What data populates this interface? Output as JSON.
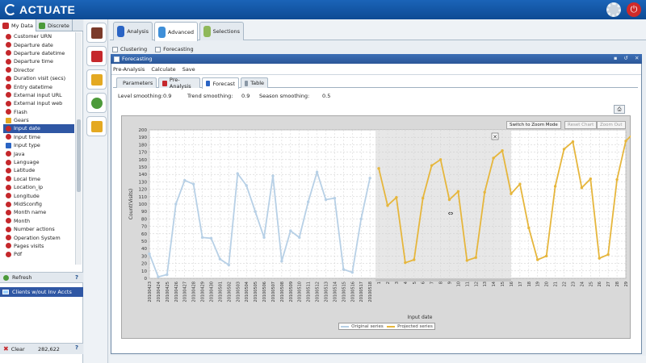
{
  "app": {
    "logo_text": "ACTUATE",
    "settings_icon": "gear-icon",
    "power_icon": "power-icon",
    "power_glyph": "⏻"
  },
  "left_panel": {
    "tabs": [
      {
        "label": "My Data",
        "color": "#c5282c",
        "active": true
      },
      {
        "label": "Discrete",
        "color": "#4c9a3a",
        "active": false
      }
    ],
    "fields": [
      {
        "label": "Customer URN",
        "icon": "red"
      },
      {
        "label": "Departure date",
        "icon": "red"
      },
      {
        "label": "Departure datetime",
        "icon": "red"
      },
      {
        "label": "Departure time",
        "icon": "red"
      },
      {
        "label": "Director",
        "icon": "red"
      },
      {
        "label": "Duration visit (secs)",
        "icon": "red"
      },
      {
        "label": "Entry datetime",
        "icon": "red"
      },
      {
        "label": "External input URL",
        "icon": "red"
      },
      {
        "label": "External input web",
        "icon": "red"
      },
      {
        "label": "Flash",
        "icon": "red"
      },
      {
        "label": "Gears",
        "icon": "yellow"
      },
      {
        "label": "Input date",
        "icon": "red",
        "selected": true
      },
      {
        "label": "Input time",
        "icon": "red"
      },
      {
        "label": "Input type",
        "icon": "blue"
      },
      {
        "label": "Java",
        "icon": "red"
      },
      {
        "label": "Language",
        "icon": "red"
      },
      {
        "label": "Latitude",
        "icon": "red"
      },
      {
        "label": "Local time",
        "icon": "red"
      },
      {
        "label": "Location_ip",
        "icon": "red"
      },
      {
        "label": "Longitude",
        "icon": "red"
      },
      {
        "label": "MidSconfig",
        "icon": "red"
      },
      {
        "label": "Month name",
        "icon": "red"
      },
      {
        "label": "Month",
        "icon": "red"
      },
      {
        "label": "Number actions",
        "icon": "red"
      },
      {
        "label": "Operation System",
        "icon": "red"
      },
      {
        "label": "Pages visits",
        "icon": "red"
      },
      {
        "label": "Pdf",
        "icon": "red"
      }
    ],
    "refresh_label": "Refresh",
    "help_glyph": "?",
    "segment_label": "Clients w/out Inv Accts",
    "clear_label": "Clear",
    "clear_count": "282,622",
    "clear_glyph": "✖"
  },
  "icon_column": [
    {
      "name": "house-icon",
      "color": "#7a3a2a"
    },
    {
      "name": "magnifier-icon",
      "color": "#c5282c"
    },
    {
      "name": "pencil-icon",
      "color": "#e4a922"
    },
    {
      "name": "pie-icon",
      "color": "#4c9a3a"
    },
    {
      "name": "document-icon",
      "color": "#e4a922"
    }
  ],
  "main_tabs": [
    {
      "label": "Analysis",
      "color": "#2a64c4",
      "active": false
    },
    {
      "label": "Advanced",
      "color": "#3f8fd8",
      "active": true
    },
    {
      "label": "Selections",
      "color": "#8fb85a",
      "active": false
    }
  ],
  "sub_tabs": [
    {
      "label": "Clustering"
    },
    {
      "label": "Forecasting"
    }
  ],
  "window": {
    "title": "Forecasting",
    "controls": "▪ ↺ ✕",
    "menu": [
      "Pre-Analysis",
      "Calculate",
      "Save"
    ],
    "tabs": [
      {
        "label": "Parameters",
        "color": "#c5282c",
        "active": false
      },
      {
        "label": "Pre-Analysis",
        "color": "#c5282c",
        "active": false
      },
      {
        "label": "Forecast",
        "color": "#2a64c4",
        "active": true
      },
      {
        "label": "Table",
        "color": "#8a98a6",
        "active": false
      }
    ],
    "smoothing": {
      "level_label": "Level smoothing:",
      "level_value": "0.9",
      "trend_label": "Trend smoothing:",
      "trend_value": "0.9",
      "season_label": "Season smoothing:",
      "season_value": "0.5"
    },
    "print_glyph": "⎙",
    "buttons": {
      "zoom_mode": "Switch to Zoom Mode",
      "reset_chart": "Reset Chart",
      "zoom_out": "Zoom Out"
    },
    "close_glyph": "✕",
    "cursor_glyph": "⇔"
  },
  "chart_data": {
    "type": "line",
    "xlabel": "Input date",
    "ylabel": "Count(Visits)",
    "ylim": [
      0,
      200
    ],
    "yticks": [
      0,
      10,
      20,
      30,
      40,
      50,
      60,
      70,
      80,
      90,
      100,
      110,
      120,
      130,
      140,
      150,
      160,
      170,
      180,
      190,
      200
    ],
    "grid": true,
    "legend_position": "bottom",
    "categories": [
      "20100423",
      "20100424",
      "20100425",
      "20100426",
      "20100427",
      "20100428",
      "20100429",
      "20100430",
      "20100501",
      "20100502",
      "20100503",
      "20100504",
      "20100505",
      "20100506",
      "20100507",
      "20100508",
      "20100509",
      "20100510",
      "20100511",
      "20100512",
      "20100513",
      "20100514",
      "20100515",
      "20100516",
      "20100517",
      "20100518",
      "1",
      "2",
      "3",
      "4",
      "5",
      "6",
      "7",
      "8",
      "9",
      "10",
      "11",
      "12",
      "13",
      "14",
      "15",
      "16",
      "17",
      "18",
      "19",
      "20",
      "21",
      "22",
      "23",
      "24",
      "25",
      "26",
      "27",
      "28",
      "29"
    ],
    "series": [
      {
        "name": "Original series",
        "color": "#b7d0e6",
        "start_index": 0,
        "values": [
          33,
          2,
          5,
          100,
          132,
          127,
          55,
          54,
          26,
          18,
          141,
          125,
          90,
          55,
          138,
          23,
          64,
          55,
          103,
          143,
          106,
          108,
          12,
          8,
          80,
          135
        ]
      },
      {
        "name": "Projected series",
        "color": "#e6b63c",
        "start_index": 26,
        "values": [
          148,
          98,
          109,
          21,
          25,
          108,
          152,
          160,
          106,
          117,
          24,
          28,
          116,
          162,
          172,
          114,
          127,
          68,
          25,
          30,
          124,
          174,
          184,
          122,
          134,
          27,
          32,
          133,
          185,
          197
        ]
      }
    ],
    "highlight_range": [
      26,
      41
    ]
  }
}
